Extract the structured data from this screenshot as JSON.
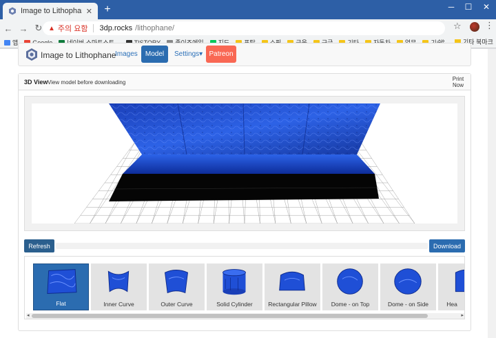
{
  "browser": {
    "tab_title": "Image to Lithophane",
    "tab_close": "✕",
    "new_tab": "+",
    "win_min": "─",
    "win_max": "☐",
    "win_close": "✕",
    "back": "←",
    "forward": "→",
    "reload": "↻",
    "security_icon": "▲",
    "security_label": "주의 요함",
    "url_host": "3dp.rocks",
    "url_path": "/lithophane/",
    "star": "☆",
    "menu": "⋮",
    "bookmarks": [
      {
        "label": "앱",
        "icon": "apps-icon",
        "color": "#4285f4"
      },
      {
        "label": "Google",
        "icon": "google-icon",
        "color": "#ea4335"
      },
      {
        "label": "네이버 스마트스토...",
        "icon": "store-icon",
        "color": "#0f7b3c"
      },
      {
        "label": "TISTORY",
        "icon": "tistory-icon",
        "color": "#333333"
      },
      {
        "label": "종이조에일",
        "icon": "page-icon",
        "color": "#888888"
      },
      {
        "label": "지도",
        "icon": "naver-icon",
        "color": "#03c75a"
      },
      {
        "label": "포탈",
        "icon": "folder-icon",
        "color": "#f5c518"
      },
      {
        "label": "쇼핑",
        "icon": "folder-icon",
        "color": "#f5c518"
      },
      {
        "label": "금융",
        "icon": "folder-icon",
        "color": "#f5c518"
      },
      {
        "label": "구글",
        "icon": "folder-icon",
        "color": "#f5c518"
      },
      {
        "label": "기타",
        "icon": "folder-icon",
        "color": "#f5c518"
      },
      {
        "label": "자동차",
        "icon": "folder-icon",
        "color": "#f5c518"
      },
      {
        "label": "업무",
        "icon": "folder-icon",
        "color": "#f5c518"
      },
      {
        "label": "기술",
        "icon": "folder-icon",
        "color": "#f5c518"
      }
    ],
    "bookmarks_more": "»",
    "bookmarks_other": "기타 북마크"
  },
  "navbar": {
    "brand": "Image to Lithophane",
    "images": "Images",
    "model": "Model",
    "settings": "Settings",
    "settings_caret": "▾",
    "patreon": "Patreon"
  },
  "panel": {
    "title": "3D View",
    "subtitle": "View model before downloading",
    "print_line1": "Print",
    "print_line2": "Now"
  },
  "actions": {
    "refresh": "Refresh",
    "download": "Download"
  },
  "shapes": [
    {
      "label": "Flat",
      "active": true
    },
    {
      "label": "Inner Curve",
      "active": false
    },
    {
      "label": "Outer Curve",
      "active": false
    },
    {
      "label": "Solid Cylinder",
      "active": false
    },
    {
      "label": "Rectangular Pillow",
      "active": false
    },
    {
      "label": "Dome - on Top",
      "active": false
    },
    {
      "label": "Dome - on Side",
      "active": false
    },
    {
      "label": "Hea",
      "active": false
    }
  ],
  "scroll": {
    "left": "◂",
    "right": "▸"
  },
  "colors": {
    "model_blue": "#1f4fd6",
    "brand_blue": "#2b6cb0",
    "patreon": "#f96854"
  }
}
